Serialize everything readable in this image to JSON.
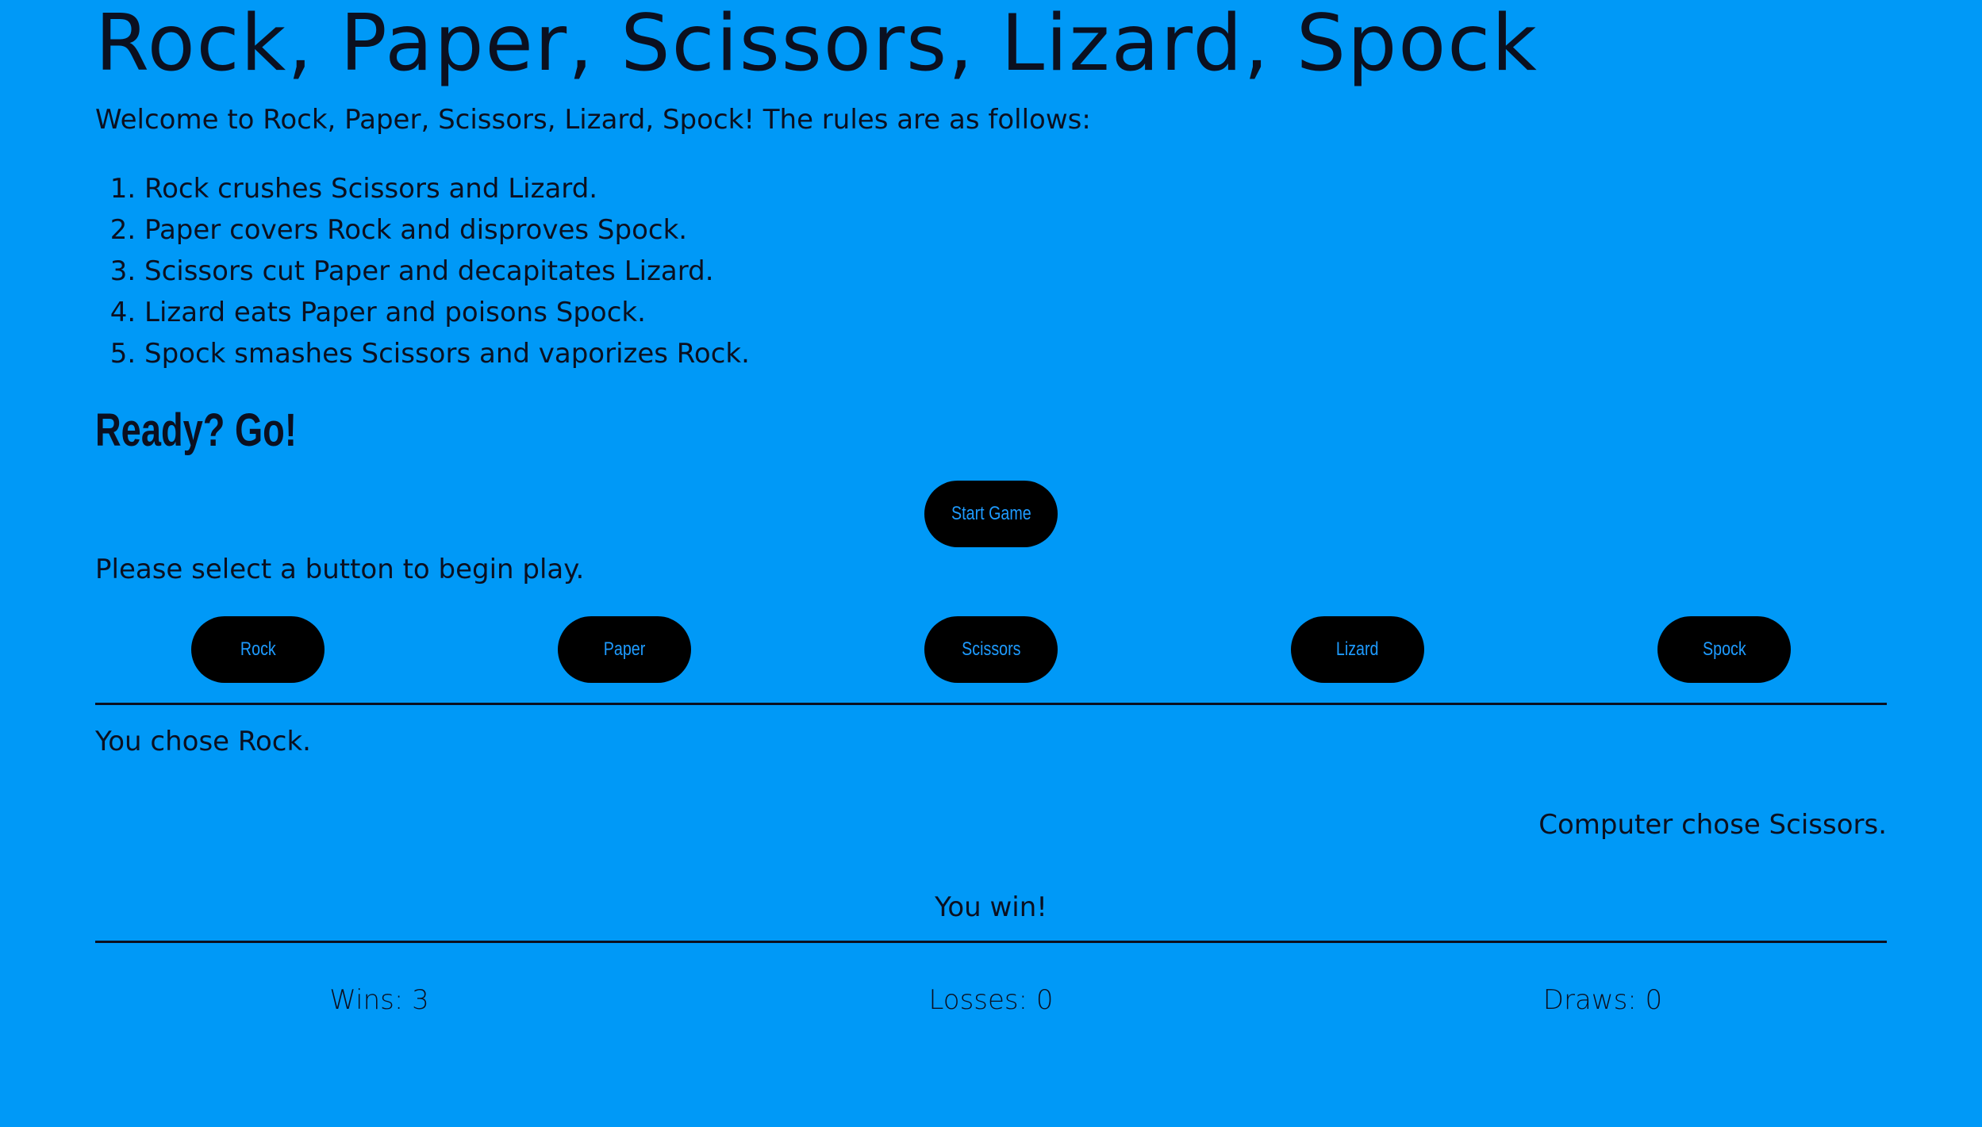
{
  "page": {
    "title": "Rock, Paper, Scissors, Lizard, Spock",
    "intro": "Welcome to Rock, Paper, Scissors, Lizard, Spock! The rules are as follows:",
    "rules": [
      "Rock crushes Scissors and Lizard.",
      "Paper covers Rock and disproves Spock.",
      "Scissors cut Paper and decapitates Lizard.",
      "Lizard eats Paper and poisons Spock.",
      "Spock smashes Scissors and vaporizes Rock."
    ],
    "ready_heading": "Ready? Go!",
    "start_button": "Start Game",
    "prompt": "Please select a button to begin play.",
    "choices": [
      "Rock",
      "Paper",
      "Scissors",
      "Lizard",
      "Spock"
    ]
  },
  "game": {
    "player_choice_text": "You chose Rock.",
    "computer_choice_text": "Computer chose Scissors.",
    "result_text": "You win!"
  },
  "scoreboard": {
    "wins": "Wins: 3",
    "losses": "Losses: 0",
    "draws": "Draws: 0"
  },
  "colors": {
    "background": "#0099f7",
    "button_background": "#000000",
    "button_text": "#1e9bff",
    "text": "#0b1020"
  }
}
